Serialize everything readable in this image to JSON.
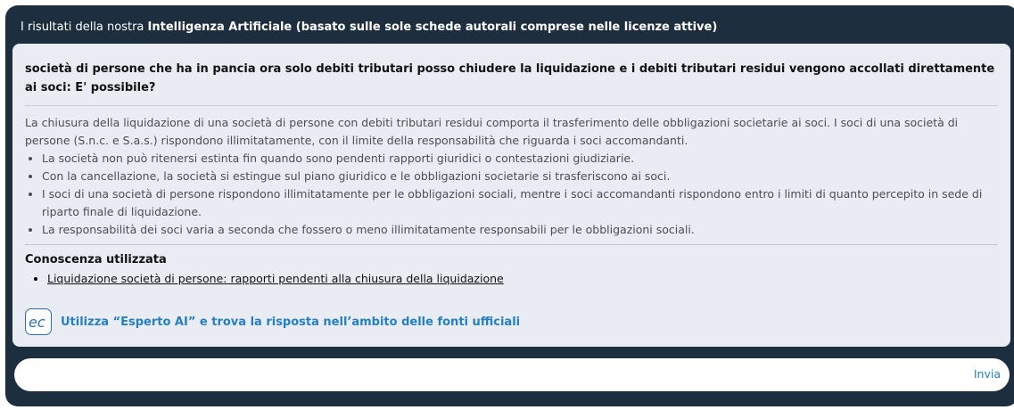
{
  "header": {
    "prefix": "I risultati della nostra ",
    "bold": "Intelligenza Artificiale (basato sulle sole schede autorali comprese nelle licenze attive)"
  },
  "question": "società di persone che ha in pancia ora solo debiti tributari posso chiudere la liquidazione e i debiti tributari residui vengono accollati direttamente ai soci: E' possibile?",
  "answer": {
    "intro": "La chiusura della liquidazione di una società di persone con debiti tributari residui comporta il trasferimento delle obbligazioni societarie ai soci. I soci di una società di persone (S.n.c. e S.a.s.) rispondono illimitatamente, con il limite della responsabilità che riguarda i soci accomandanti.",
    "bullets": [
      "La società non può ritenersi estinta fin quando sono pendenti rapporti giuridici o contestazioni giudiziarie.",
      "Con la cancellazione, la società si estingue sul piano giuridico e le obbligazioni societarie si trasferiscono ai soci.",
      "I soci di una società di persone rispondono illimitatamente per le obbligazioni sociali, mentre i soci accomandanti rispondono entro i limiti di quanto percepito in sede di riparto finale di liquidazione.",
      "La responsabilità dei soci varia a seconda che fossero o meno illimitatamente responsabili per le obbligazioni sociali."
    ]
  },
  "knowledge": {
    "title": "Conoscenza utilizzata",
    "links": [
      "Liquidazione società di persone: rapporti pendenti alla chiusura della liquidazione"
    ]
  },
  "esperto": {
    "logo_text": "ec",
    "label": "Utilizza “Esperto AI” e trova la risposta nell’ambito delle fonti ufficiali"
  },
  "input": {
    "value": "",
    "placeholder": "",
    "send_label": "Invia"
  },
  "colors": {
    "panel": "#1d2f3f",
    "card": "#e9ecf3",
    "accent": "#2580c3"
  }
}
